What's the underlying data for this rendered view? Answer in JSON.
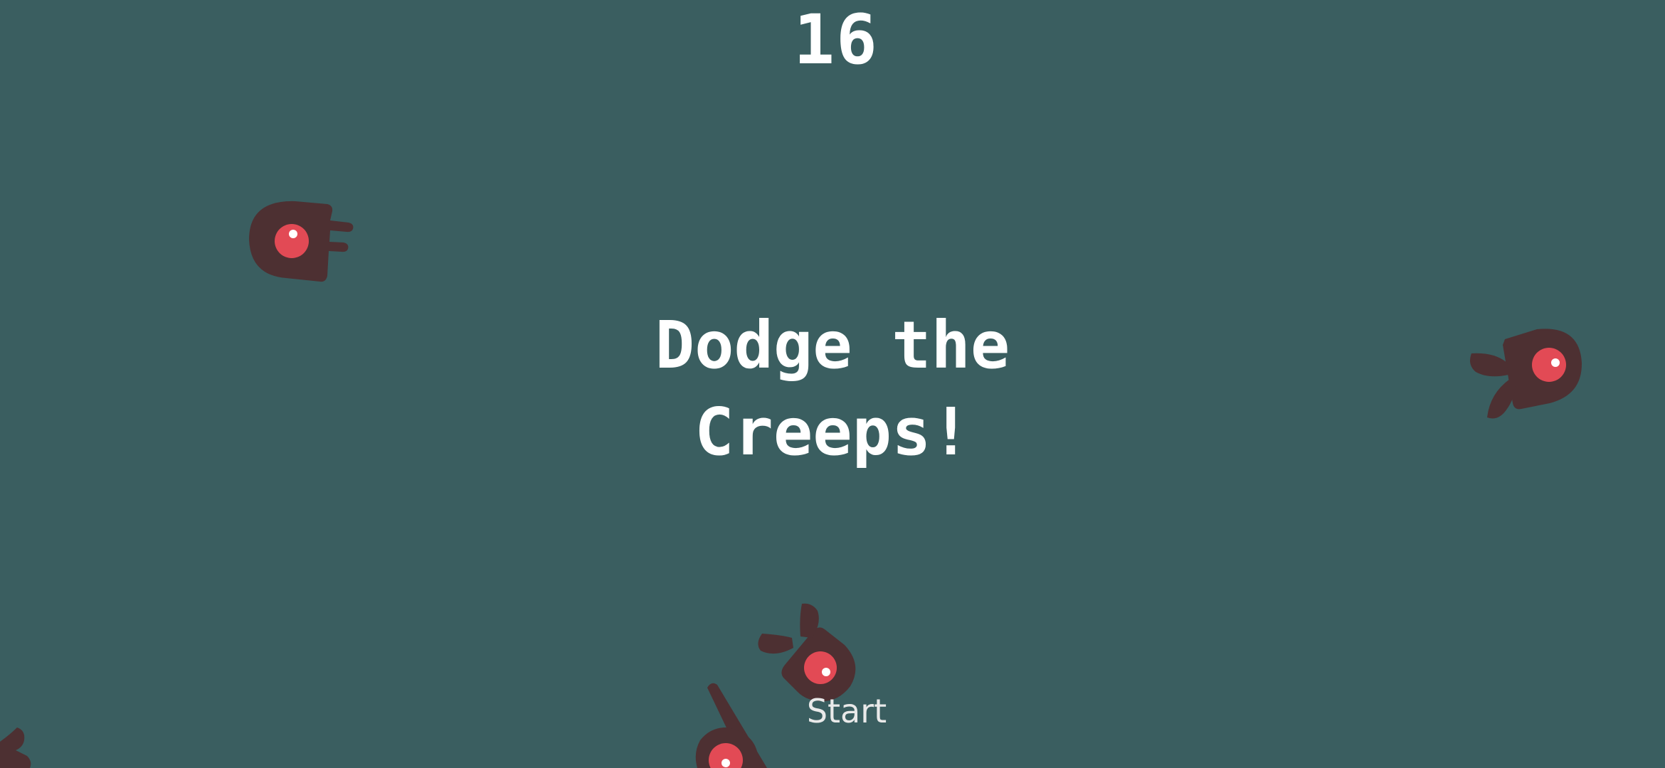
{
  "hud": {
    "score": "16",
    "message": "Dodge the\nCreeps!",
    "start_label": "Start"
  },
  "colors": {
    "background": "#3a5e60",
    "creep_body": "#4d3032",
    "creep_eye": "#e24a55",
    "creep_pupil": "#ffffff",
    "text": "#ffffff"
  },
  "entities": {
    "creeps": [
      {
        "name": "creep-top-left",
        "kind": "swimmer"
      },
      {
        "name": "creep-right",
        "kind": "flyer"
      },
      {
        "name": "creep-bottom-center",
        "kind": "flyer"
      },
      {
        "name": "creep-bottom-lower",
        "kind": "walker"
      },
      {
        "name": "creep-bottom-left-edge",
        "kind": "flyer"
      }
    ]
  }
}
